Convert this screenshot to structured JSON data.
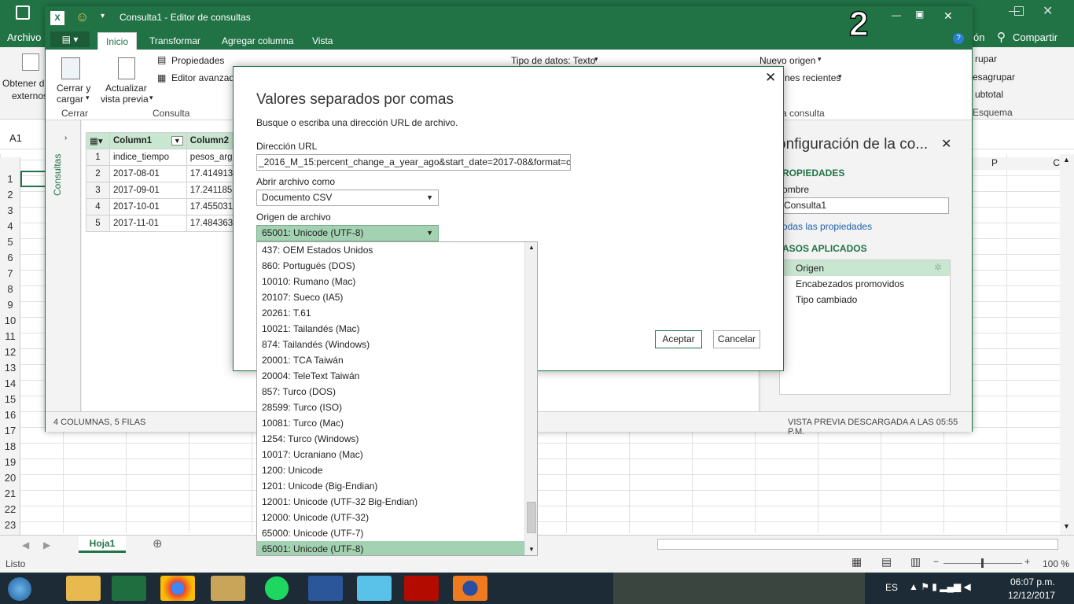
{
  "colors": {
    "excel_green": "#217346",
    "selected_green": "#a3d2b2",
    "header_green": "#c8e6d0"
  },
  "excel": {
    "tabs": {
      "file": "Archivo",
      "fragment_right": "ón",
      "share": "Compartir"
    },
    "ribbon": {
      "obtain_line1": "Obtener d",
      "obtain_line2": "externos",
      "outline_group": "rupar",
      "ungroup": "esagrupar",
      "subtotal": "ubtotal",
      "outline_label": "Esquema"
    },
    "name_box": "A1",
    "rows": [
      "1",
      "2",
      "3",
      "4",
      "5",
      "6",
      "7",
      "8",
      "9",
      "10",
      "11",
      "12",
      "13",
      "14",
      "15",
      "16",
      "17",
      "18",
      "19",
      "20",
      "21",
      "22",
      "23"
    ],
    "col_p": "P",
    "col_q": "C",
    "sheet_tab": "Hoja1",
    "status_ready": "Listo",
    "zoom": "100 %"
  },
  "pq": {
    "title": "Consulta1 - Editor de consultas",
    "tabs": [
      "Inicio",
      "Transformar",
      "Agregar columna",
      "Vista"
    ],
    "ribbon": {
      "close_load_1": "Cerrar y",
      "close_load_2": "cargar",
      "refresh_1": "Actualizar",
      "refresh_2": "vista previa",
      "properties": "Propiedades",
      "adv_editor": "Editor avanzad",
      "data_type": "Tipo de datos: Texto",
      "new_source": "Nuevo origen",
      "recent_sources": "nes recientes",
      "group_close": "Cerrar",
      "group_query": "Consulta",
      "group_query_right": "a consulta"
    },
    "queries_panel_label": "Consultas",
    "table": {
      "headers": [
        "Column1",
        "Column2"
      ],
      "rows": [
        [
          "1",
          "indice_tiempo",
          "pesos_arge"
        ],
        [
          "2",
          "2017-08-01",
          "17.4149130"
        ],
        [
          "3",
          "2017-09-01",
          "17.2411857"
        ],
        [
          "4",
          "2017-10-01",
          "17.4550318"
        ],
        [
          "5",
          "2017-11-01",
          "17.4843636"
        ]
      ]
    },
    "settings": {
      "title": "onfiguración de la co...",
      "properties_heading": "ROPIEDADES",
      "name_label": "ombre",
      "name_value": "Consulta1",
      "all_props_link": "odas las propiedades",
      "steps_heading": "ASOS APLICADOS",
      "steps": [
        "Origen",
        "Encabezados promovidos",
        "Tipo cambiado"
      ]
    },
    "status_left": "4 COLUMNAS, 5 FILAS",
    "status_right": "VISTA PREVIA DESCARGADA A LAS 05:55 P.M."
  },
  "dialog": {
    "title": "Valores separados por comas",
    "subtitle": "Busque o escriba una dirección URL de archivo.",
    "url_label": "Dirección URL",
    "url_value": "_2016_M_15:percent_change_a_year_ago&start_date=2017-08&format=csv",
    "open_as_label": "Abrir archivo como",
    "open_as_value": "Documento CSV",
    "origin_label": "Origen de archivo",
    "origin_value": "65001: Unicode (UTF-8)",
    "ok": "Aceptar",
    "cancel": "Cancelar",
    "options": [
      "437: OEM Estados Unidos",
      "860: Portugués (DOS)",
      "10010: Rumano (Mac)",
      "20107: Sueco (IA5)",
      "20261: T.61",
      "10021: Tailandés (Mac)",
      "874: Tailandés (Windows)",
      "20001: TCA Taiwán",
      "20004: TeleText Taiwán",
      "857: Turco (DOS)",
      "28599: Turco (ISO)",
      "10081: Turco (Mac)",
      "1254: Turco (Windows)",
      "10017: Ucraniano (Mac)",
      "1200: Unicode",
      "1201: Unicode (Big-Endian)",
      "12001: Unicode (UTF-32 Big-Endian)",
      "12000: Unicode (UTF-32)",
      "65000: Unicode (UTF-7)",
      "65001: Unicode (UTF-8)"
    ]
  },
  "overlay_number": "2",
  "taskbar": {
    "lang": "ES",
    "time": "06:07 p.m.",
    "date": "12/12/2017"
  }
}
